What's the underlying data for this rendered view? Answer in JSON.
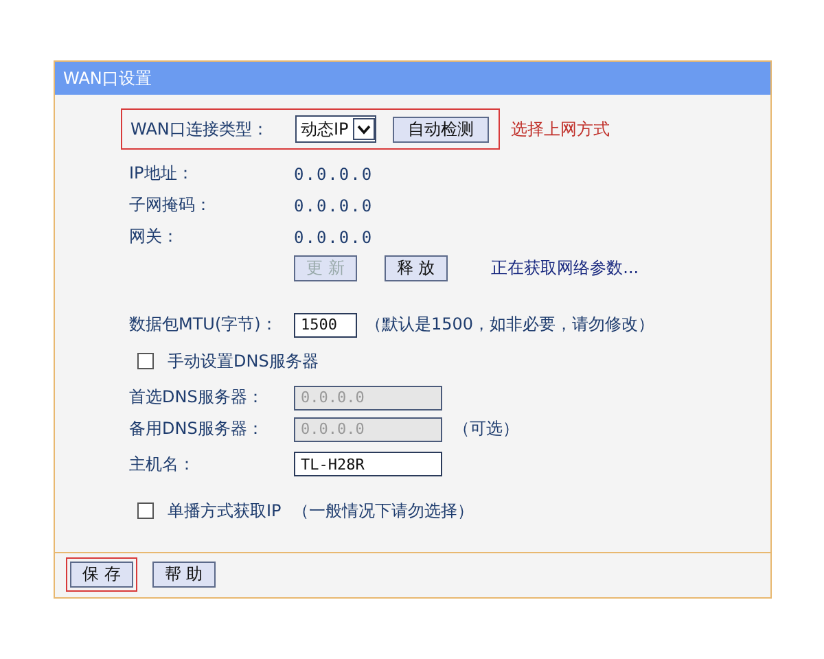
{
  "panel": {
    "title": "WAN口设置"
  },
  "connection_type": {
    "label": "WAN口连接类型：",
    "value": "动态IP",
    "detect_button": "自动检测",
    "highlighted": true,
    "note": "选择上网方式"
  },
  "status": [
    {
      "label": "IP地址：",
      "value": "0.0.0.0"
    },
    {
      "label": "子网掩码：",
      "value": "0.0.0.0"
    },
    {
      "label": "网关：",
      "value": "0.0.0.0"
    }
  ],
  "actions": [
    {
      "label": "更 新",
      "disabled": true
    },
    {
      "label": "释 放",
      "disabled": false
    }
  ],
  "status_message": "正在获取网络参数...",
  "mtu": {
    "label": "数据包MTU(字节)：",
    "value": "1500",
    "hint": "（默认是1500，如非必要，请勿修改）"
  },
  "manual_dns": {
    "label": "手动设置DNS服务器",
    "checked": false
  },
  "dns": [
    {
      "label": "首选DNS服务器：",
      "value": "0.0.0.0",
      "disabled": true
    },
    {
      "label": "备用DNS服务器：",
      "value": "0.0.0.0",
      "disabled": true,
      "note": "（可选）"
    }
  ],
  "hostname": {
    "label": "主机名：",
    "value": "TL-H28R"
  },
  "unicast": {
    "label": "单播方式获取IP",
    "hint": "（一般情况下请勿选择）",
    "checked": false
  },
  "footer_buttons": [
    {
      "label": "保 存",
      "highlighted": true
    },
    {
      "label": "帮 助",
      "highlighted": false
    }
  ]
}
